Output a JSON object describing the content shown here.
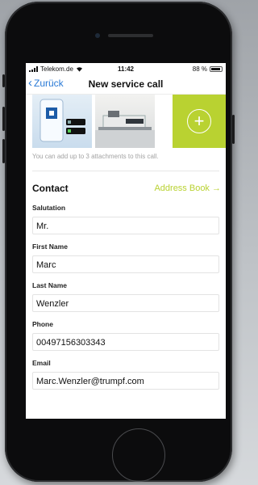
{
  "status_bar": {
    "carrier": "Telekom.de",
    "time": "11:42",
    "battery": "88 %"
  },
  "nav": {
    "back_label": "Zurück",
    "title": "New service call"
  },
  "attachments": {
    "hint": "You can add up to 3 attachments to this call.",
    "accent_color": "#b9d231"
  },
  "contact": {
    "heading": "Contact",
    "address_book_label": "Address Book →"
  },
  "fields": [
    {
      "label": "Salutation",
      "value": "Mr."
    },
    {
      "label": "First Name",
      "value": "Marc"
    },
    {
      "label": "Last Name",
      "value": "Wenzler"
    },
    {
      "label": "Phone",
      "value": "00497156303343"
    },
    {
      "label": "Email",
      "value": "Marc.Wenzler@trumpf.com"
    }
  ]
}
